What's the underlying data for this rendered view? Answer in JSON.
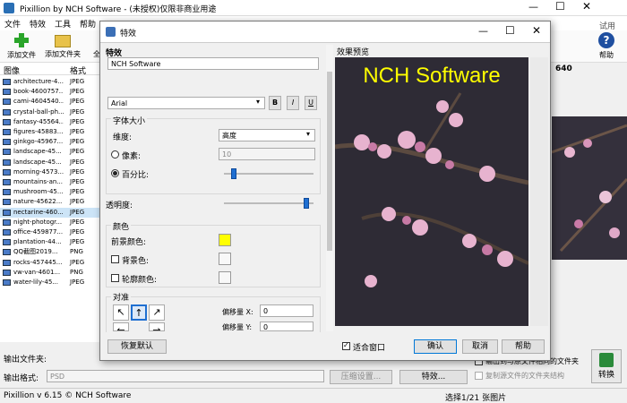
{
  "app": {
    "title": "Pixillion by NCH Software - (未授权)仅限非商业用途",
    "trial_label": "试用版",
    "menu": [
      "文件",
      "特效",
      "工具",
      "帮助"
    ],
    "toolbar": {
      "add_file": "添加文件",
      "add_folder": "添加文件夹",
      "truncated": "全",
      "help": "帮助"
    },
    "list_headers": {
      "image": "图像",
      "format": "格式"
    },
    "files": [
      {
        "name": "architecture-4...",
        "format": "JPEG"
      },
      {
        "name": "book-4600757...",
        "format": "JPEG"
      },
      {
        "name": "cami-4604540...",
        "format": "JPEG"
      },
      {
        "name": "crystal-ball-ph...",
        "format": "JPEG"
      },
      {
        "name": "fantasy-45564...",
        "format": "JPEG"
      },
      {
        "name": "figures-45883...",
        "format": "JPEG"
      },
      {
        "name": "ginkgo-45967...",
        "format": "JPEG"
      },
      {
        "name": "landscape-45...",
        "format": "JPEG"
      },
      {
        "name": "landscape-45...",
        "format": "JPEG"
      },
      {
        "name": "morning-4573...",
        "format": "JPEG"
      },
      {
        "name": "mountains-an...",
        "format": "JPEG"
      },
      {
        "name": "mushroom-45...",
        "format": "JPEG"
      },
      {
        "name": "nature-45622...",
        "format": "JPEG"
      },
      {
        "name": "nectarine-460...",
        "format": "JPEG"
      },
      {
        "name": "night-photogr...",
        "format": "JPEG"
      },
      {
        "name": "office-459877...",
        "format": "JPEG"
      },
      {
        "name": "plantation-44...",
        "format": "JPEG"
      },
      {
        "name": "QQ截图2019...",
        "format": "PNG"
      },
      {
        "name": "rocks-457445...",
        "format": "JPEG"
      },
      {
        "name": "vw-van-4601...",
        "format": "PNG"
      },
      {
        "name": "water-lily-45...",
        "format": "JPEG"
      }
    ],
    "selected_index": 13,
    "right_value": "640",
    "bottom": {
      "output_folder_label": "输出文件夹:",
      "output_format_label": "输出格式:",
      "format_value": "PSD",
      "compress_button": "压缩设置...",
      "effects_button": "特效...",
      "same_folder": "输出到与原文件相同的文件夹",
      "copy_structure": "复制源文件的文件夹结构",
      "convert_button": "转换"
    },
    "status": {
      "version": "Pixillion v 6.15 © NCH Software",
      "selection": "选择1/21 张图片"
    }
  },
  "dialog": {
    "title": "特效",
    "left_header": "特效",
    "right_header": "效果预览",
    "text_value": "NCH Software",
    "font_value": "Arial",
    "bold": "B",
    "italic": "I",
    "underline": "U",
    "font_size_group": "字体大小",
    "dimension_label": "维度:",
    "dimension_value": "高度",
    "pixels_label": "像素:",
    "pixels_value": "10",
    "percent_label": "百分比:",
    "percent_level": 0.08,
    "opacity_label": "透明度:",
    "opacity_level": 0.95,
    "color_group": "颜色",
    "fg_color_label": "前景颜色:",
    "fg_color": "#ffff00",
    "bg_color_label": "背景色:",
    "outline_color_label": "轮廓颜色:",
    "align_group": "对准",
    "offset_x_label": "偏移量 X:",
    "offset_x_value": "0",
    "offset_y_label": "偏移量 Y:",
    "offset_y_value": "0",
    "reset_button": "恢复默认",
    "fit_window_label": "适合窗口",
    "ok_button": "确认",
    "cancel_button": "取消",
    "help_button": "帮助",
    "preview_text": "NCH Software"
  }
}
